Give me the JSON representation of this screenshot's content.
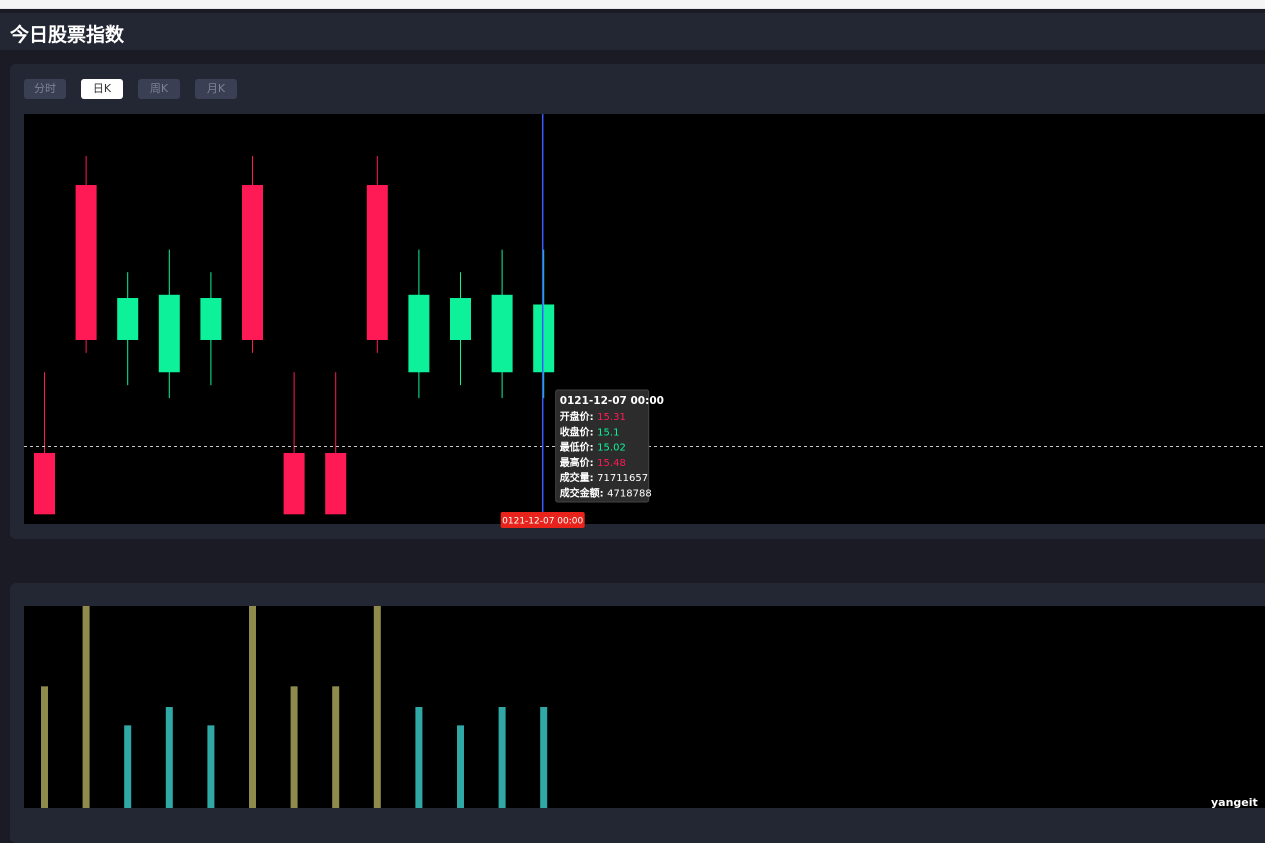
{
  "page": {
    "title": "今日股票指数"
  },
  "tabs": [
    {
      "label": "分时",
      "active": false
    },
    {
      "label": "日K",
      "active": true
    },
    {
      "label": "周K",
      "active": false
    },
    {
      "label": "月K",
      "active": false
    }
  ],
  "colors": {
    "up": "#ff1a55",
    "down": "#0df29a",
    "vol_up": "#8e8b4d",
    "vol_down": "#30a9a6",
    "crosshair": "#3a5bff",
    "marker_bg": "#e8231b"
  },
  "chart_data": [
    {
      "type": "candlestick",
      "categories": [
        "",
        "",
        "",
        "",
        "",
        "",
        "",
        "",
        "",
        "",
        "",
        "",
        ""
      ],
      "ylim": [
        14.63,
        15.9
      ],
      "series": [
        {
          "values": [
            {
              "open": 14.66,
              "close": 14.85,
              "low": 14.67,
              "high": 15.1,
              "dir": "up"
            },
            {
              "open": 15.2,
              "close": 15.68,
              "low": 15.16,
              "high": 15.77,
              "dir": "up"
            },
            {
              "open": 15.2,
              "close": 15.33,
              "low": 15.06,
              "high": 15.41,
              "dir": "down"
            },
            {
              "open": 15.1,
              "close": 15.34,
              "low": 15.02,
              "high": 15.48,
              "dir": "down"
            },
            {
              "open": 15.2,
              "close": 15.33,
              "low": 15.06,
              "high": 15.41,
              "dir": "down"
            },
            {
              "open": 15.2,
              "close": 15.68,
              "low": 15.16,
              "high": 15.77,
              "dir": "up"
            },
            {
              "open": 14.66,
              "close": 14.85,
              "low": 14.67,
              "high": 15.1,
              "dir": "up"
            },
            {
              "open": 14.66,
              "close": 14.85,
              "low": 14.67,
              "high": 15.1,
              "dir": "up"
            },
            {
              "open": 15.2,
              "close": 15.68,
              "low": 15.16,
              "high": 15.77,
              "dir": "up"
            },
            {
              "open": 15.1,
              "close": 15.34,
              "low": 15.02,
              "high": 15.48,
              "dir": "down"
            },
            {
              "open": 15.2,
              "close": 15.33,
              "low": 15.06,
              "high": 15.41,
              "dir": "down"
            },
            {
              "open": 15.1,
              "close": 15.34,
              "low": 15.02,
              "high": 15.48,
              "dir": "down"
            },
            {
              "open": 15.31,
              "close": 15.1,
              "low": 15.02,
              "high": 15.48,
              "dir": "down"
            }
          ]
        }
      ],
      "crosshair_index": 12,
      "crosshair_price": 14.87,
      "axis_marker": "0121-12-07 00:00",
      "tooltip": {
        "date": "0121-12-07 00:00",
        "rows": [
          {
            "label": "开盘价: ",
            "value": "15.31",
            "color": "#ff1a55"
          },
          {
            "label": "收盘价: ",
            "value": "15.1",
            "color": "#0df29a"
          },
          {
            "label": "最低价: ",
            "value": "15.02",
            "color": "#0df29a"
          },
          {
            "label": "最高价: ",
            "value": "15.48",
            "color": "#ff1a55"
          },
          {
            "label": "成交量: ",
            "value": "71711657",
            "color": "#ffffff"
          },
          {
            "label": "成交金额: ",
            "value": "4718788",
            "color": "#ffffff"
          }
        ]
      }
    },
    {
      "type": "bar",
      "categories": [
        "",
        "",
        "",
        "",
        "",
        "",
        "",
        "",
        "",
        "",
        "",
        "",
        ""
      ],
      "ylim": [
        0,
        88
      ],
      "series": [
        {
          "values": [
            53,
            94,
            36,
            44,
            36,
            94,
            53,
            53,
            94,
            44,
            36,
            44,
            44
          ]
        }
      ]
    }
  ],
  "watermark": "yangeit"
}
